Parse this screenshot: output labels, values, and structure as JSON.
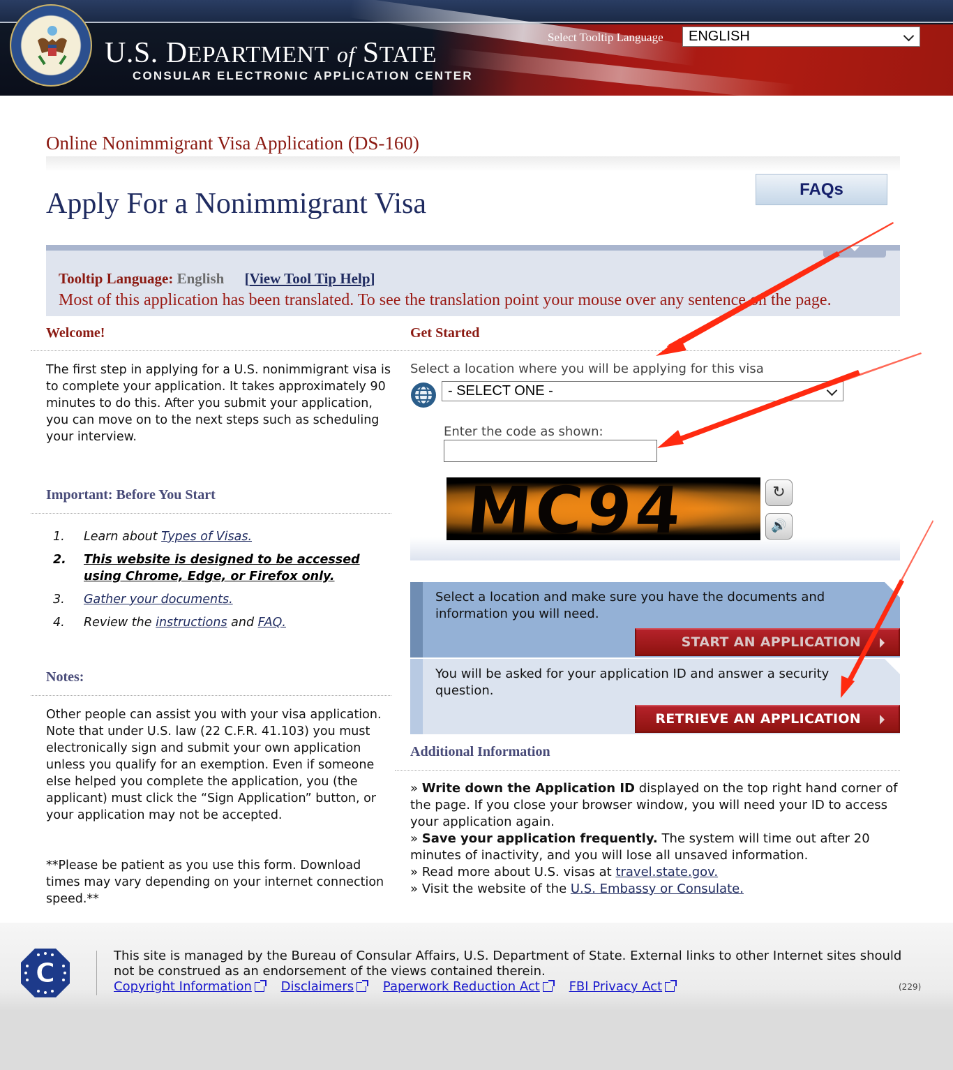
{
  "header": {
    "agency_title_prefix": "U.S. D",
    "agency_title_dept": "EPARTMENT",
    "agency_title_of": "of",
    "agency_title_s": "S",
    "agency_title_state": "TATE",
    "subtitle": "CONSULAR ELECTRONIC APPLICATION CENTER",
    "tooltip_language_label": "Select Tooltip Language",
    "tooltip_language_value": "ENGLISH"
  },
  "page": {
    "form_title": "Online Nonimmigrant Visa Application (DS-160)",
    "main_title": "Apply For a Nonimmigrant Visa",
    "faq_button": "FAQs"
  },
  "tooltip_band": {
    "label": "Tooltip Language:",
    "value": "English",
    "help_open": "[",
    "help_link": "View Tool Tip Help",
    "help_close": "]",
    "message": "Most of this application has been translated. To see the translation point your mouse over any sentence on the page."
  },
  "welcome": {
    "heading": "Welcome!",
    "text": "The first step in applying for a U.S. nonimmigrant visa is to complete your application. It takes approximately 90 minutes to do this. After you submit your application, you can move on to the next steps such as scheduling your interview."
  },
  "important": {
    "heading": "Important: Before You Start",
    "items": [
      {
        "num": "1.",
        "prefix": "Learn about ",
        "link": "Types of Visas."
      },
      {
        "num": "2.",
        "link": "This website is designed to be accessed using Chrome, Edge, or Firefox only."
      },
      {
        "num": "3.",
        "link": "Gather your documents."
      },
      {
        "num": "4.",
        "prefix": "Review the ",
        "link": "instructions",
        "middle": " and ",
        "link2": "FAQ."
      }
    ]
  },
  "notes": {
    "heading": "Notes:",
    "text1": "Other people can assist you with your visa application. Note that under U.S. law (22 C.F.R. 41.103) you must electronically sign and submit your own application unless you qualify for an exemption. Even if someone else helped you complete the application, you (the applicant) must click the “Sign Application” button, or your application may not be accepted.",
    "text2": "**Please be patient as you use this form. Download times may vary depending on your internet connection speed.**"
  },
  "get_started": {
    "heading": "Get Started",
    "location_label": "Select a location where you will be applying for this visa",
    "location_value": "- SELECT ONE -",
    "code_label": "Enter the code as shown:",
    "code_value": "",
    "captcha_text": "MC94",
    "refresh_icon": "↻",
    "audio_icon": "🔊"
  },
  "actions": {
    "start_text": "Select a location and make sure you have the documents and information you will need.",
    "start_button": "START AN APPLICATION",
    "retrieve_text": "You will be asked for your application ID and answer a security question.",
    "retrieve_button": "RETRIEVE AN APPLICATION"
  },
  "additional": {
    "heading": "Additional Information",
    "items": [
      {
        "bullet": "» ",
        "bold": "Write down the Application ID",
        "text": " displayed on the top right hand corner of the page. If you close your browser window, you will need your ID to access your application again."
      },
      {
        "bullet": "» ",
        "bold": "Save your application frequently.",
        "text": " The system will time out after 20 minutes of inactivity, and you will lose all unsaved information."
      },
      {
        "bullet": "» ",
        "text": "Read more about U.S. visas at ",
        "link": "travel.state.gov."
      },
      {
        "bullet": "» ",
        "text": "Visit the website of the ",
        "link": "U.S. Embassy or Consulate."
      }
    ]
  },
  "footer": {
    "text": "This site is managed by the Bureau of Consular Affairs, U.S. Department of State. External links to other Internet sites should not be construed as an endorsement of the views contained therein.",
    "links": [
      "Copyright Information",
      "Disclaimers",
      "Paperwork Reduction Act",
      "FBI Privacy Act"
    ],
    "count": "(229)",
    "logo_letter": "C"
  },
  "colors": {
    "brand_red": "#8b1a12",
    "navy": "#1f2b60",
    "annotation_arrow": "#ff2a10"
  }
}
